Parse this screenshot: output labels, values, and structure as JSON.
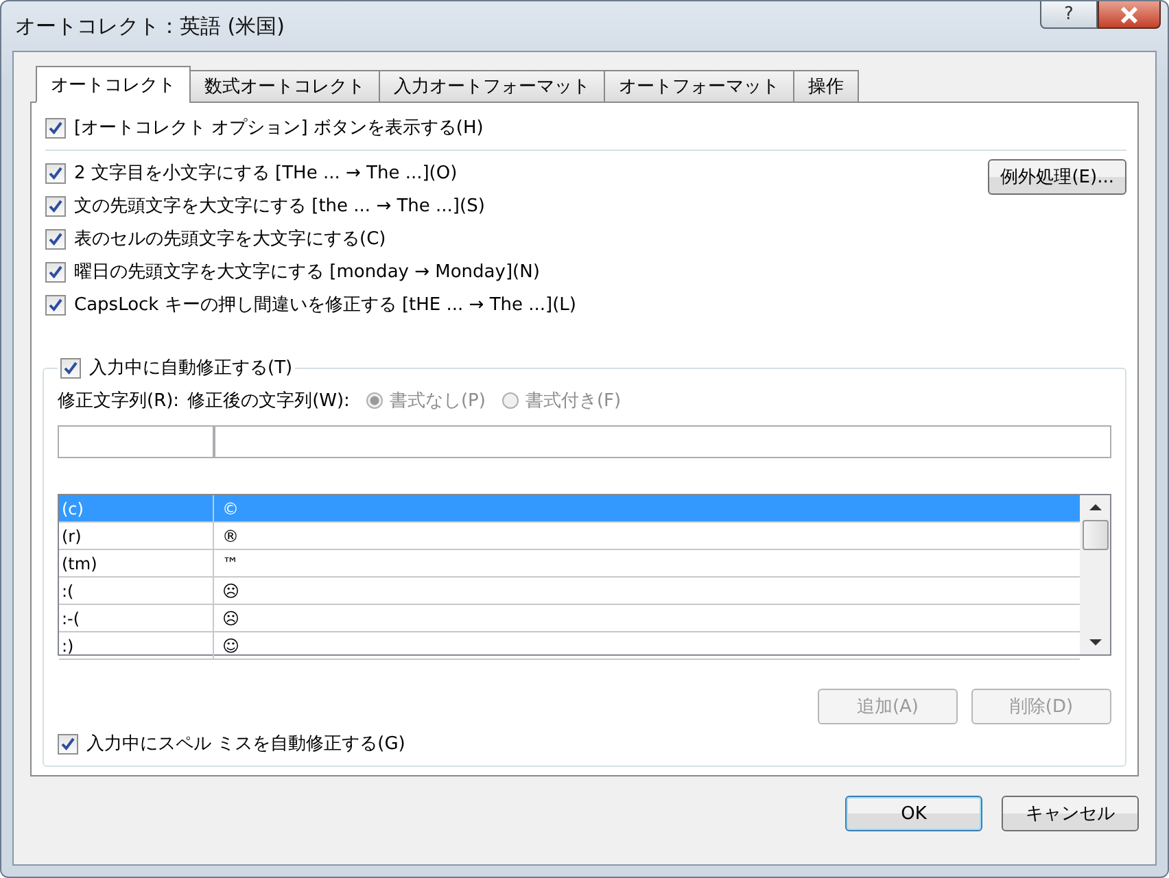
{
  "window": {
    "title": "オートコレクト：英語 (米国)",
    "help_label": "?"
  },
  "tabs": [
    {
      "label": "オートコレクト",
      "selected": true
    },
    {
      "label": "数式オートコレクト",
      "selected": false
    },
    {
      "label": "入力オートフォーマット",
      "selected": false
    },
    {
      "label": "オートフォーマット",
      "selected": false
    },
    {
      "label": "操作",
      "selected": false
    }
  ],
  "show_options_button": {
    "label": "[オートコレクト オプション] ボタンを表示する(H)",
    "checked": true
  },
  "options": [
    {
      "label": "2 文字目を小文字にする [THe ... → The ...](O)",
      "checked": true
    },
    {
      "label": "文の先頭文字を大文字にする [the ... → The ...](S)",
      "checked": true
    },
    {
      "label": "表のセルの先頭文字を大文字にする(C)",
      "checked": true
    },
    {
      "label": "曜日の先頭文字を大文字にする [monday →  Monday](N)",
      "checked": true
    },
    {
      "label": "CapsLock キーの押し間違いを修正する [tHE ... → The ...](L)",
      "checked": true
    }
  ],
  "exceptions_button": "例外処理(E)...",
  "replace_group": {
    "label": "入力中に自動修正する(T)",
    "checked": true,
    "replace_label": "修正文字列(R):",
    "with_label": "修正後の文字列(W):",
    "radios": [
      {
        "label": "書式なし(P)",
        "selected": true,
        "disabled": true
      },
      {
        "label": "書式付き(F)",
        "selected": false,
        "disabled": true
      }
    ],
    "rows": [
      {
        "replace": "(c)",
        "with": "©",
        "selected": true
      },
      {
        "replace": "(r)",
        "with": "®",
        "selected": false
      },
      {
        "replace": "(tm)",
        "with": "™",
        "selected": false
      },
      {
        "replace": ":(",
        "with": "☹",
        "selected": false
      },
      {
        "replace": ":-(",
        "with": "☹",
        "selected": false
      },
      {
        "replace": ":)",
        "with": "☺",
        "selected": false
      }
    ],
    "buttons": [
      {
        "label": "追加(A)",
        "disabled": true
      },
      {
        "label": "削除(D)",
        "disabled": true
      }
    ],
    "spell": {
      "label": "入力中にスペル ミスを自動修正する(G)",
      "checked": true
    }
  },
  "footer_buttons": [
    {
      "label": "OK",
      "default": true
    },
    {
      "label": "キャンセル",
      "default": false
    }
  ]
}
